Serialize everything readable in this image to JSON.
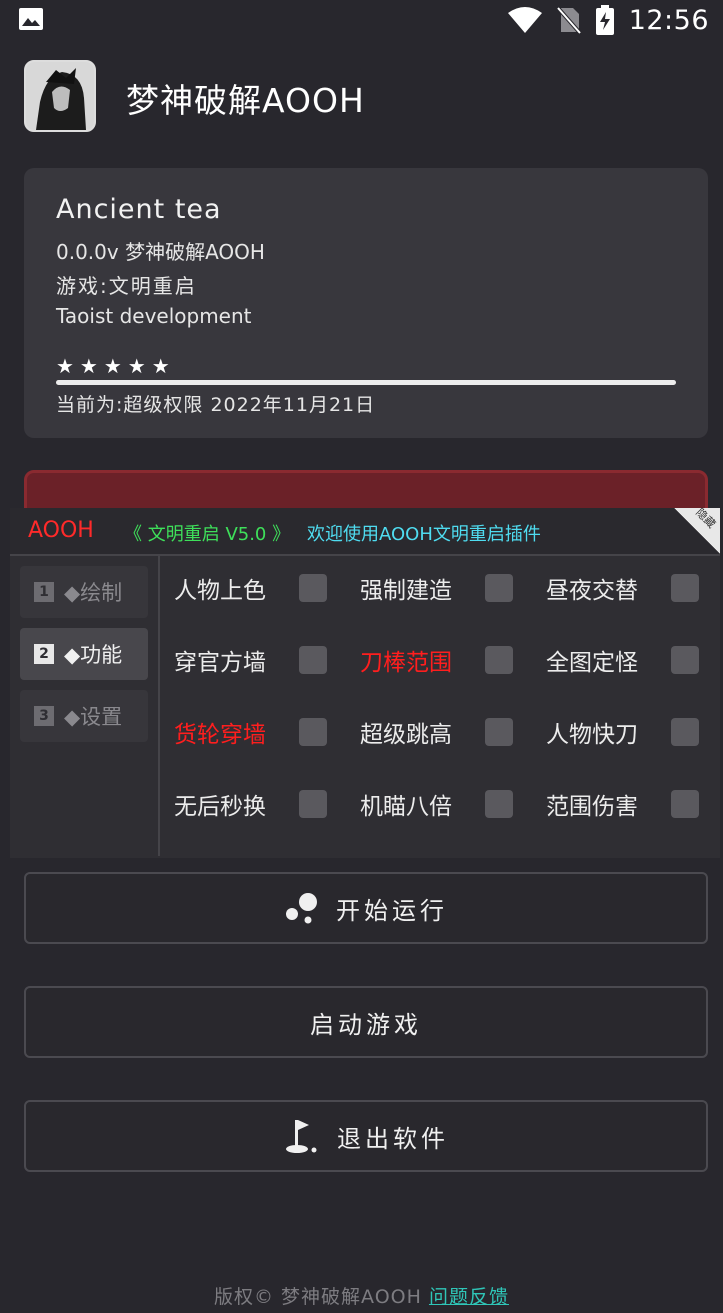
{
  "status_bar": {
    "time": "12:56",
    "icons": [
      "image-icon",
      "wifi-icon",
      "no-sim-icon",
      "battery-charging-icon"
    ]
  },
  "header": {
    "title": "梦神破解AOOH"
  },
  "info_card": {
    "name": "Ancient tea",
    "version_line": "0.0.0v  梦神破解AOOH",
    "game_line": "游戏:文明重启",
    "dev_line": "Taoist development",
    "stars": "★★★★★",
    "rating": 5,
    "progress": 1.0,
    "permission_line": "当前为:超级权限  2022年11月21日"
  },
  "plugin": {
    "brand": "AOOH",
    "version": "《 文明重启 V5.0 》",
    "welcome": "欢迎使用AOOH文明重启插件",
    "corner_label": "隐藏",
    "tabs": [
      {
        "num": "1",
        "label": "◆绘制"
      },
      {
        "num": "2",
        "label": "◆功能"
      },
      {
        "num": "3",
        "label": "◆设置"
      }
    ],
    "options": [
      {
        "label": "人物上色",
        "color": "#ececec"
      },
      {
        "label": "强制建造",
        "color": "#ececec"
      },
      {
        "label": "昼夜交替",
        "color": "#ececec"
      },
      {
        "label": "穿官方墙",
        "color": "#ececec"
      },
      {
        "label": "刀棒范围",
        "color": "#ff1e1e"
      },
      {
        "label": "全图定怪",
        "color": "#ececec"
      },
      {
        "label": "货轮穿墙",
        "color": "#ff1e1e"
      },
      {
        "label": "超级跳高",
        "color": "#ececec"
      },
      {
        "label": "人物快刀",
        "color": "#ececec"
      },
      {
        "label": "无后秒换",
        "color": "#ececec"
      },
      {
        "label": "机瞄八倍",
        "color": "#ececec"
      },
      {
        "label": "范围伤害",
        "color": "#ececec"
      }
    ]
  },
  "buttons": {
    "start": "开始运行",
    "launch": "启动游戏",
    "exit": "退出软件"
  },
  "footer": {
    "copyright": "版权© 梦神破解AOOH ",
    "feedback": "问题反馈"
  }
}
